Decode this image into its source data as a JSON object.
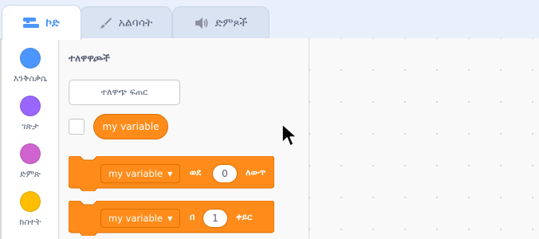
{
  "tabs": [
    {
      "label": "ኮድ",
      "icon": "code-icon"
    },
    {
      "label": "አልባሳት",
      "icon": "brush-icon"
    },
    {
      "label": "ድምጾች",
      "icon": "speaker-icon"
    }
  ],
  "categories": [
    {
      "label": "እንቅስቃሴ",
      "color": "#4c97ff"
    },
    {
      "label": "ገጽታ",
      "color": "#9966ff"
    },
    {
      "label": "ድምጽ",
      "color": "#cf63cf"
    },
    {
      "label": "ክስተት",
      "color": "#ffbf00"
    }
  ],
  "palette": {
    "title": "ተለዋዋጮች",
    "make_variable_label": "ተለዋጭ ፍጠር",
    "reporter_label": "my variable",
    "set_block": {
      "variable": "my variable",
      "word": "ወደ",
      "value": "0",
      "suffix": "ለውጥ"
    },
    "change_block": {
      "variable": "my variable",
      "word": "በ",
      "value": "1",
      "suffix": "ቀይር"
    }
  },
  "colors": {
    "accent": "#4c97ff",
    "variables": "#ff8c1a"
  }
}
